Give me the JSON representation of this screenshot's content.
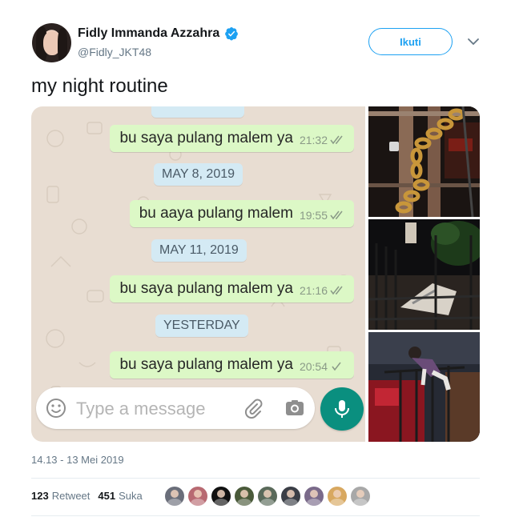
{
  "author": {
    "display_name": "Fidly Immanda Azzahra",
    "handle": "@Fidly_JKT48",
    "verified": true
  },
  "follow_button": {
    "label": "Ikuti"
  },
  "tweet_text": "my night routine",
  "chat": {
    "messages": [
      {
        "text": "bu saya pulang malem ya",
        "time": "21:32",
        "ticks": "read"
      },
      {
        "date": "MAY 8, 2019"
      },
      {
        "text": "bu aaya pulang malem",
        "time": "19:55",
        "ticks": "read"
      },
      {
        "date": "MAY 11, 2019"
      },
      {
        "text": "bu saya pulang malem ya",
        "time": "21:16",
        "ticks": "read"
      },
      {
        "date": "YESTERDAY"
      },
      {
        "text": "bu saya pulang malem ya",
        "time": "20:54",
        "ticks": "sent"
      }
    ],
    "input_placeholder": "Type a message",
    "icons": [
      "emoji-icon",
      "paperclip-icon",
      "camera-icon",
      "microphone-icon"
    ]
  },
  "photos": [
    "photo-chained-gate",
    "photo-fence-at-night",
    "photo-climbing-gate"
  ],
  "timestamp": "14.13 - 13 Mei 2019",
  "stats": {
    "retweets_count": "123",
    "retweets_label": "Retweet",
    "likes_count": "451",
    "likes_label": "Suka"
  },
  "likers_count": 9,
  "colors": {
    "accent": "#1da1f2",
    "bubble": "#dcf8c6",
    "date_pill": "#d4eaf4",
    "whatsapp_green": "#0a8f7f",
    "chat_bg": "#e8ddd2"
  }
}
